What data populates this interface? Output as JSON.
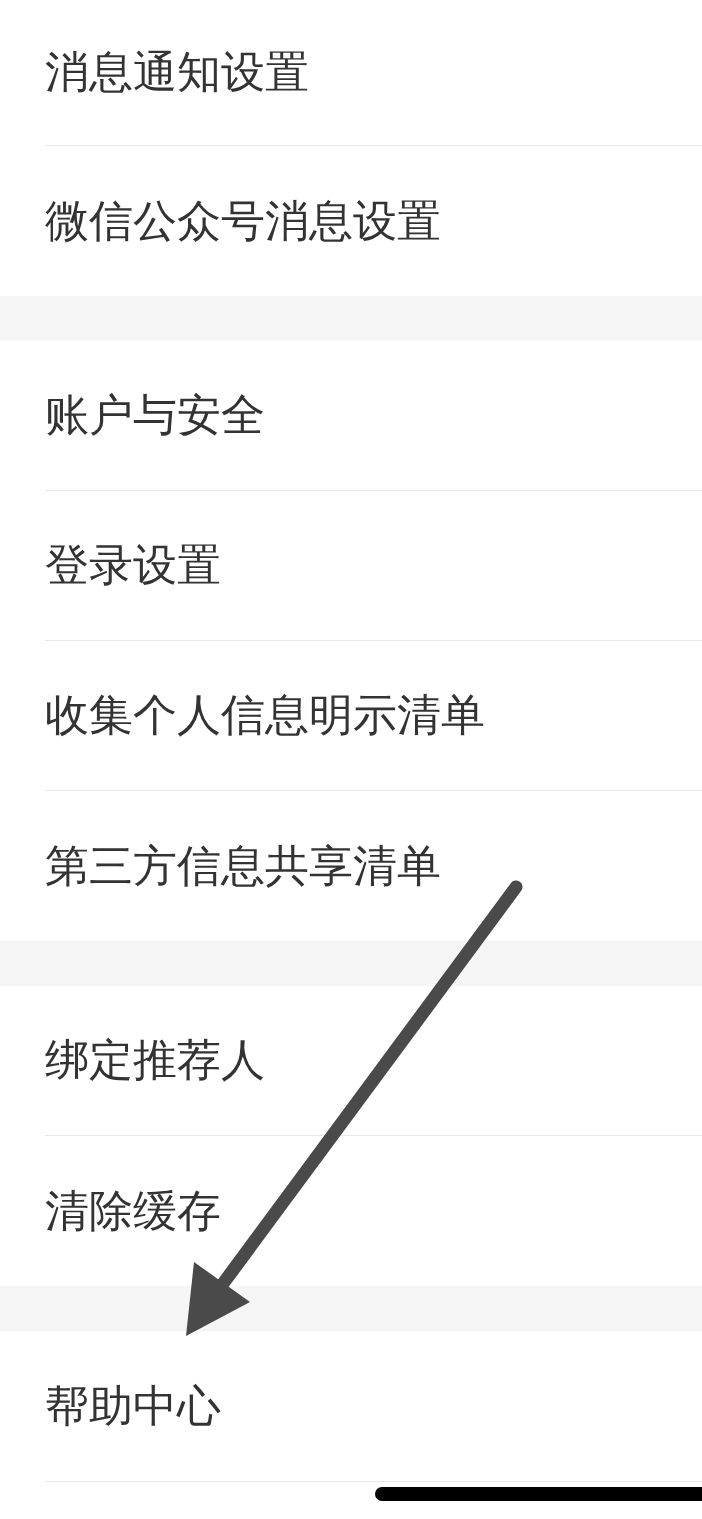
{
  "groups": [
    {
      "items": [
        {
          "label": "消息通知设置"
        },
        {
          "label": "微信公众号消息设置"
        }
      ]
    },
    {
      "items": [
        {
          "label": "账户与安全"
        },
        {
          "label": "登录设置"
        },
        {
          "label": "收集个人信息明示清单"
        },
        {
          "label": "第三方信息共享清单"
        }
      ]
    },
    {
      "items": [
        {
          "label": "绑定推荐人"
        },
        {
          "label": "清除缓存"
        }
      ]
    },
    {
      "items": [
        {
          "label": "帮助中心"
        }
      ]
    }
  ]
}
